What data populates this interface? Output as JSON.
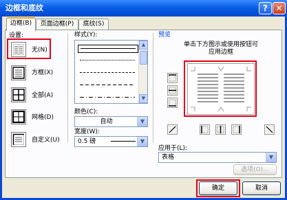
{
  "window": {
    "title": "边框和底纹"
  },
  "titlebar_buttons": {
    "help": "?",
    "close": "✕"
  },
  "tabs": [
    {
      "label": "边框(B)",
      "active": true
    },
    {
      "label": "页面边框(P)",
      "active": false
    },
    {
      "label": "底纹(S)",
      "active": false
    }
  ],
  "setting": {
    "label": "设置:",
    "options": [
      {
        "label": "无(N)",
        "icon": "border-none-icon",
        "selected": true
      },
      {
        "label": "方框(X)",
        "icon": "border-box-icon",
        "selected": false
      },
      {
        "label": "全部(A)",
        "icon": "border-all-icon",
        "selected": false
      },
      {
        "label": "网格(D)",
        "icon": "border-grid-icon",
        "selected": false
      },
      {
        "label": "自定义(U)",
        "icon": "border-custom-icon",
        "selected": false
      }
    ]
  },
  "style": {
    "label": "样式(Y):",
    "selected_index": 0
  },
  "color": {
    "label": "颜色(C):",
    "value": "自动"
  },
  "width": {
    "label": "宽度(W):",
    "value": "0.5 磅"
  },
  "preview": {
    "label": "预览",
    "hint_line1": "单击下方图示或使用按钮可",
    "hint_line2": "应用边框"
  },
  "apply_to": {
    "label": "应用于(L):",
    "value": "表格"
  },
  "options_button": "选项(O)...",
  "ok_button": "确定",
  "cancel_button": "取消",
  "colors": {
    "title_bar": "#0a5fe6",
    "highlight": "#e2001a",
    "tab_accent": "#f5a30d"
  }
}
